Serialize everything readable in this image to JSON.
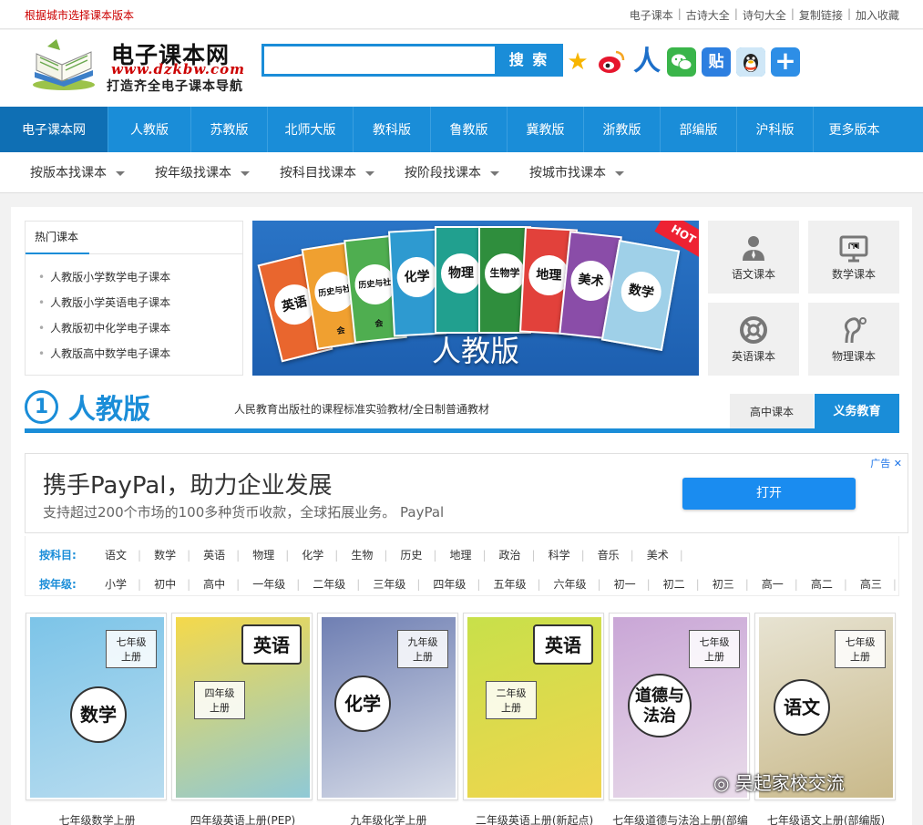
{
  "topbar": {
    "tip": "根据城市选择课本版本",
    "links": [
      "电子课本",
      "古诗大全",
      "诗句大全",
      "复制链接",
      "加入收藏"
    ]
  },
  "header": {
    "logo_title": "电子课本网",
    "logo_url": "www.dzkbw.com",
    "logo_slogan": "打造齐全电子课本导航",
    "search_placeholder": "",
    "search_label": "搜 索"
  },
  "share": [
    {
      "icon": "qzone-icon",
      "glyph": "★",
      "color": "#f7b500"
    },
    {
      "icon": "weibo-icon",
      "glyph": "微",
      "color": "#e6162d"
    },
    {
      "icon": "renren-icon",
      "glyph": "人",
      "color": "#1d6fc9"
    },
    {
      "icon": "wechat-icon",
      "glyph": "信",
      "color": "#3ab54a"
    },
    {
      "icon": "tieba-icon",
      "glyph": "贴",
      "color": "#2d7fe0"
    },
    {
      "icon": "qq-icon",
      "glyph": "Q",
      "color": "#3aa0e8"
    },
    {
      "icon": "more-share-icon",
      "glyph": "+",
      "color": "#2d8ee6"
    }
  ],
  "mainnav": [
    "电子课本网",
    "人教版",
    "苏教版",
    "北师大版",
    "教科版",
    "鲁教版",
    "冀教版",
    "浙教版",
    "部编版",
    "沪科版",
    "更多版本"
  ],
  "subnav": [
    "按版本找课本",
    "按年级找课本",
    "按科目找课本",
    "按阶段找课本",
    "按城市找课本"
  ],
  "hot": {
    "title": "热门课本",
    "items": [
      "人教版小学数学电子课本",
      "人教版小学英语电子课本",
      "人教版初中化学电子课本",
      "人教版高中数学电子课本"
    ]
  },
  "banner": {
    "caption": "人教版",
    "badge": "HOT",
    "books": [
      "英语",
      "历史与社会",
      "化学",
      "物理",
      "生物学",
      "地理",
      "美术",
      "数学"
    ]
  },
  "subjects": [
    "语文课本",
    "数学课本",
    "英语课本",
    "物理课本"
  ],
  "section": {
    "number": "1",
    "title": "人教版",
    "desc": "人民教育出版社的课程标准实验教材/全日制普通教材",
    "tab_high": "高中课本",
    "tab_compulsory": "义务教育"
  },
  "ad": {
    "title": "携手PayPal，助力企业发展",
    "desc": "支持超过200个市场的100多种货币收款，全球拓展业务。 PayPal",
    "open": "打开",
    "label": "广告 ✕"
  },
  "filters": {
    "subject_label": "按科目:",
    "subjects": [
      "语文",
      "数学",
      "英语",
      "物理",
      "化学",
      "生物",
      "历史",
      "地理",
      "政治",
      "科学",
      "音乐",
      "美术"
    ],
    "grade_label": "按年级:",
    "grades": [
      "小学",
      "初中",
      "高中",
      "一年级",
      "二年级",
      "三年级",
      "四年级",
      "五年级",
      "六年级",
      "初一",
      "初二",
      "初三",
      "高一",
      "高二",
      "高三"
    ]
  },
  "books": [
    {
      "title": "七年级数学上册",
      "seal": "数学",
      "grade": "七年级\n上册",
      "colors": [
        "#7cc4e8",
        "#b8dcef"
      ]
    },
    {
      "title": "四年级英语上册(PEP)",
      "seal": "英语",
      "grade": "四年级\n上册",
      "colors": [
        "#f5d94a",
        "#8fc9d6"
      ]
    },
    {
      "title": "九年级化学上册",
      "seal": "化学",
      "grade": "九年级\n上册",
      "colors": [
        "#6f7fb3",
        "#d7dce8"
      ]
    },
    {
      "title": "二年级英语上册(新起点)",
      "seal": "英语",
      "grade": "二年级\n上册",
      "colors": [
        "#c8e04a",
        "#f0d54e"
      ]
    },
    {
      "title": "七年级道德与法治上册(部编",
      "seal": "道德与法治",
      "grade": "七年级\n上册",
      "colors": [
        "#c9a6d6",
        "#e9dcea"
      ]
    },
    {
      "title": "七年级语文上册(部编版)",
      "seal": "语文",
      "grade": "七年级\n上册",
      "colors": [
        "#e7e3d2",
        "#c9b98a"
      ]
    }
  ],
  "watermark": "吴起家校交流"
}
